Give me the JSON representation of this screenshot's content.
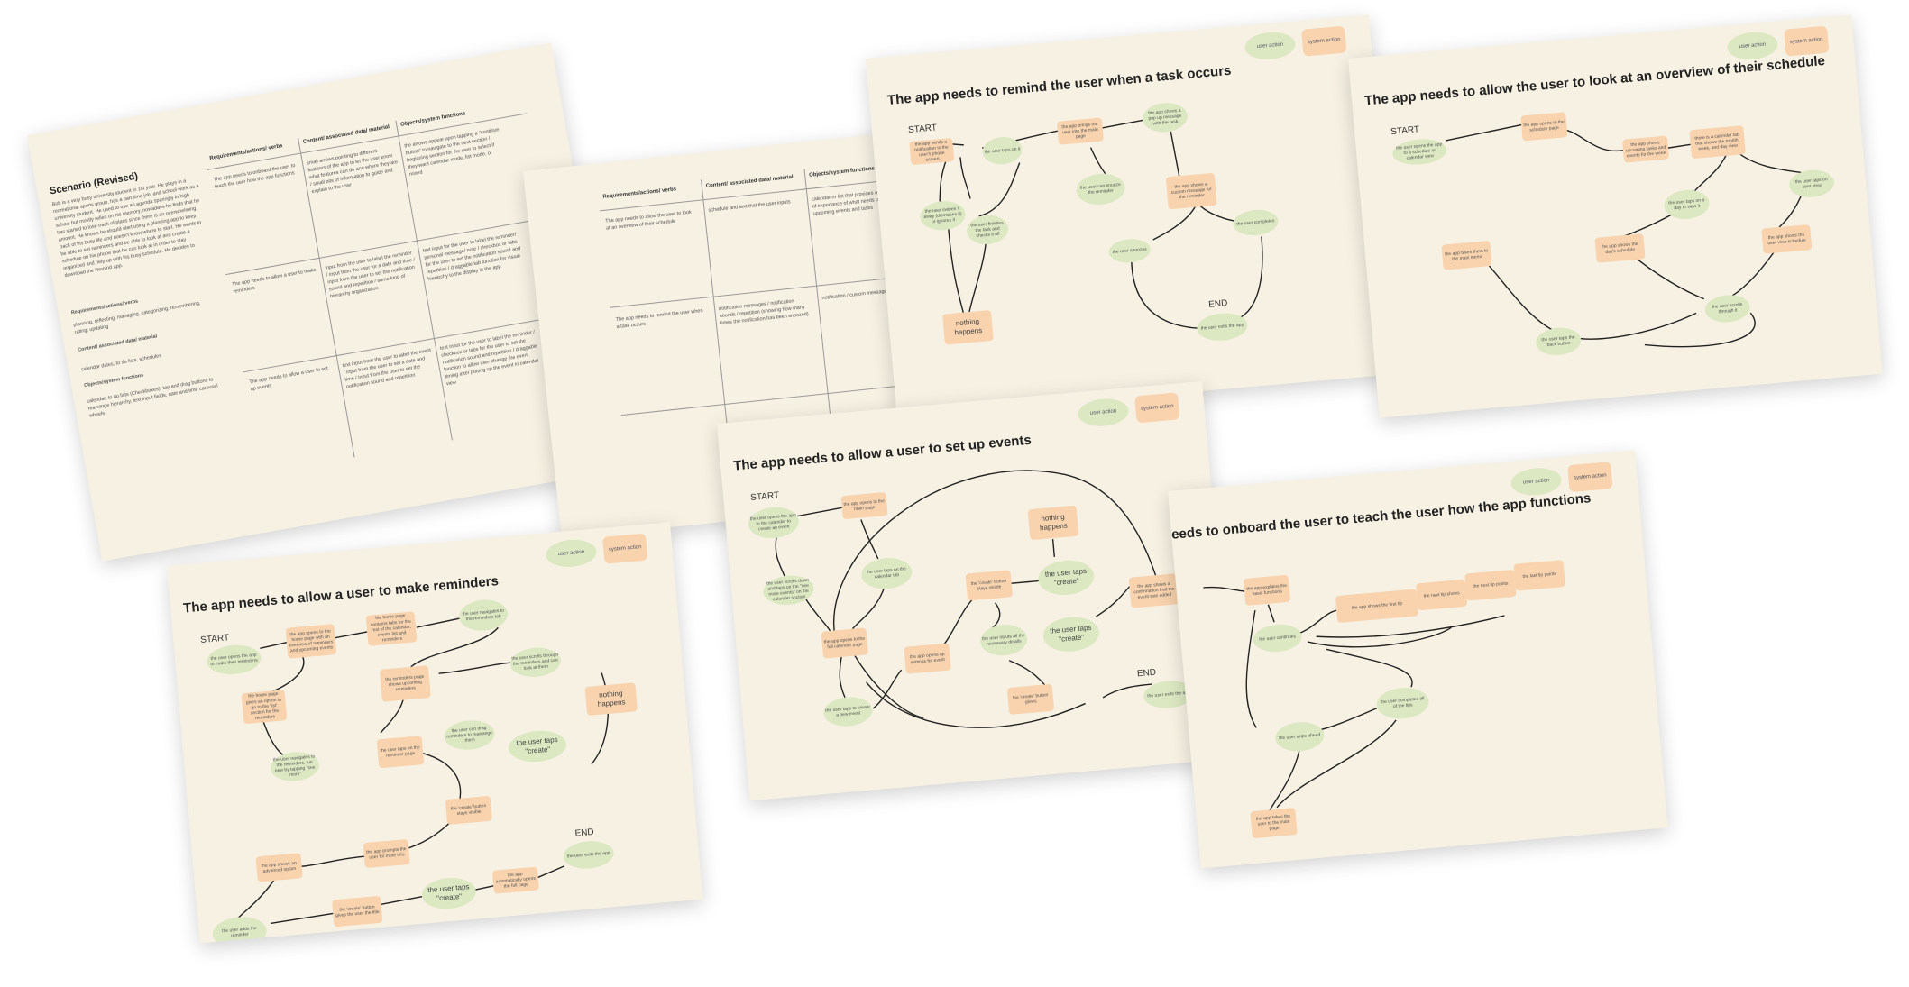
{
  "legend": {
    "user_action": "user action",
    "system_action": "system action"
  },
  "scenario_card": {
    "title": "Scenario (Revised)",
    "body": "Bob is a very busy university student in 1st year. He plays in a recreational sports group, has a part time job, and school work as a university student. He used to use an agenda sparingly in high school but mostly relied on his memory, nowadays he finds that he has started to lose track of plans since there is an overwhelming amount. He knows he should start using a planning app to keep track of his busy life and doesn't know where to start. He wants to be able to set reminders and be able to look at and create a schedule on his phone that he can look at in order to stay organized and help up with his busy schedule. He decides to download the Remind app.",
    "req_label": "Requirements/actions/ verbs",
    "req_text": "planning, reflecting, managing, categorizing, remembering, rating, updating",
    "content_label": "Content/ associated data/ material",
    "content_text": "calendar dates, to do lists, schedules",
    "obj_label": "Objects/system functions",
    "obj_text": "calendar, to do lists (Checkboxes), tap and drag buttons to rearrange hierarchy, text input fields, date and time carousel wheels",
    "headers": [
      "Requirements/actions/ verbs",
      "Content/ associated data/ material",
      "Objects/system functions"
    ],
    "rows": [
      [
        "The app needs to onboard the user to teach the user how the app functions",
        "small arrows pointing to different features of the app to let the user know what features can do and where they are / small bits of information to guide and explain to the user",
        "the arrows appear upon tapping a \"continue button\" to navigate to the next section / beginning section for the user to select if they want calendar mode, list mode, or mixed"
      ],
      [
        "The app needs to allow a user to make reminders",
        "input from the user to label the reminder / input from the user for a date and time / input from the user to set the notification sound and repetition / some kind of hierarchy organization",
        "text input for the user to label the reminder/ personal message/ note / checkbox or tabs for the user to set the notification sound and repetition / draggable tab function for visual hierarchy to the display in the app"
      ],
      [
        "The app needs to allow a user to set up events",
        "text input from the user to label the event / input from the user to set a date and time / input from the user to set the notification sound and repetition",
        "text input for the user to label the reminder / checkbox or tabs for the user to set the notification sound and repetition / draggable function to allow user change the event timing after putting up the event in calendar view"
      ]
    ]
  },
  "table2_card": {
    "headers": [
      "Requirements/actions/ verbs",
      "Content/ associated data/ material",
      "Objects/system functions"
    ],
    "rows": [
      [
        "The app needs to allow the user to look at an overview of their schedule",
        "schedule and text that the user inputs",
        "calendar or list that provides a hierarchy of importance of what needs to be done/ upcoming events and tasks"
      ],
      [
        "The app needs to remind the user when a task occurs",
        "notification messages / notification sounds / repetition (showing how many times the notification has been snoozed)",
        "notification / custom message input"
      ]
    ]
  },
  "remind_card": {
    "title": "The app needs to remind the user when a task occurs",
    "start": "START",
    "end": "END",
    "nothing": "nothing happens",
    "nodes": [
      "the app sends a notification to the user's phone screen",
      "the user swipes it away (dismisses it) or ignores it",
      "the user taps on it",
      "the app brings the user into the main page",
      "the user finishes the task and checks it off",
      "the app shows a pop up message with the task",
      "the user can snooze the reminder",
      "the app shows a custom message for the reminder",
      "the user snoozes",
      "the user completes",
      "the user exits the app"
    ]
  },
  "overview_card": {
    "title": "The app needs to allow the user to look at an overview of their schedule",
    "start": "START",
    "nodes": [
      "the user opens the app to a schedule or calendar view",
      "the app opens to the schedule page",
      "the app shows upcoming tasks and events for the week",
      "there is a calendar tab that shows the month, week, and day view",
      "the user taps on a day to view it",
      "the user taps on user view",
      "the app shows the day's schedule",
      "the app shows the user view schedule",
      "the app takes them to the main menu",
      "the user taps the back button",
      "the user scrolls through it"
    ]
  },
  "reminders_card": {
    "title": "The app needs to allow a user to make reminders",
    "start": "START",
    "end": "END",
    "nothing": "nothing happens",
    "create": "the user taps \"create\"",
    "nodes": [
      "the user opens the app to make their reminders",
      "the app opens to the home page with an overview of reminders and upcoming events",
      "the home page contains tabs for the rest of the calendar, events list and reminders",
      "the user navigates to the reminders tab",
      "the home page gives an option to go to the 'list' section for the reminders",
      "the user navigates to the reminders, fun new by tapping \"see more\"",
      "the reminders page shows upcoming reminders",
      "the user scrolls through the reminders and can look at them",
      "the user can drag reminders to rearrange them",
      "the user taps on the reminder page",
      "the 'create' button stays visible",
      "the app shows an advanced option",
      "the app prompts the user for more info",
      "the user adds the reminder",
      "the 'create' button gives the user the title",
      "the app automatically opens the full page",
      "the user exits the app"
    ]
  },
  "events_card": {
    "title": "The app needs to allow a user to set up events",
    "start": "START",
    "end": "END",
    "nothing": "nothing happens",
    "create": "the user taps \"create\"",
    "nodes": [
      "the user opens the app to the calendar to create an event",
      "the app opens to the main page",
      "the user scrolls down and taps on the \"see more events\" on the calendar section",
      "the user taps on the calendar tab",
      "the app opens to the full calendar page",
      "the 'create' button stays visible",
      "the user taps to create a new event",
      "the app opens up settings for event",
      "the user inputs all the necessary details",
      "the 'create' button glows",
      "the app shows a confirmation that the event was added",
      "the user exits the app"
    ]
  },
  "onboard_card": {
    "title": "eeds to onboard the user to teach the user how the app functions",
    "nodes": [
      "the app explains the basic functions",
      "the user continues",
      "the app shows the first tip",
      "the next tip shows",
      "the next tip points",
      "the last tip points",
      "the user skips ahead",
      "the user completes all of the tips",
      "the app takes the user to the main page"
    ]
  }
}
